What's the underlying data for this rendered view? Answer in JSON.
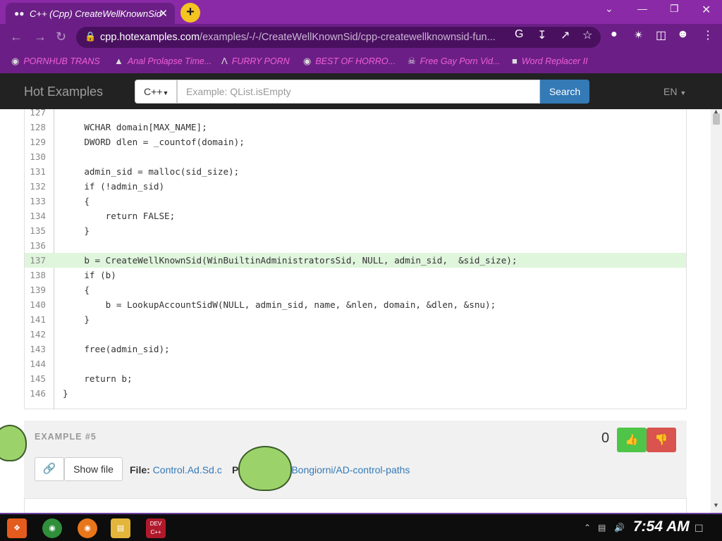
{
  "browser": {
    "tab_title": "C++ (Cpp) CreateWellKnownSid",
    "new_tab_label": "+",
    "url_domain": "cpp.hotexamples.com",
    "url_path": "/examples/-/-/CreateWellKnownSid/cpp-createwellknownsid-fun..."
  },
  "bookmarks": [
    {
      "label": "PORNHUB TRANS",
      "icon": "globe-icon"
    },
    {
      "label": "Anal Prolapse Time...",
      "icon": "flame-icon"
    },
    {
      "label": "FURRY PORN",
      "icon": "lambda-icon"
    },
    {
      "label": "BEST OF HORRO...",
      "icon": "globe-icon"
    },
    {
      "label": "Free Gay Porn Vid...",
      "icon": "skull-icon"
    },
    {
      "label": "Word Replacer II",
      "icon": "wr-icon"
    }
  ],
  "navbar": {
    "brand": "Hot Examples",
    "language_select": "C++",
    "search_placeholder": "Example: QList.isEmpty",
    "search_button": "Search",
    "locale": "EN"
  },
  "code": {
    "highlight_line": "137",
    "lines": [
      {
        "n": "127",
        "t": ""
      },
      {
        "n": "128",
        "t": "    WCHAR domain[MAX_NAME];"
      },
      {
        "n": "129",
        "t": "    DWORD dlen = _countof(domain);"
      },
      {
        "n": "130",
        "t": ""
      },
      {
        "n": "131",
        "t": "    admin_sid = malloc(sid_size);"
      },
      {
        "n": "132",
        "t": "    if (!admin_sid)"
      },
      {
        "n": "133",
        "t": "    {"
      },
      {
        "n": "134",
        "t": "        return FALSE;"
      },
      {
        "n": "135",
        "t": "    }"
      },
      {
        "n": "136",
        "t": ""
      },
      {
        "n": "137",
        "t": "    b = CreateWellKnownSid(WinBuiltinAdministratorsSid, NULL, admin_sid,  &sid_size);"
      },
      {
        "n": "138",
        "t": "    if (b)"
      },
      {
        "n": "139",
        "t": "    {"
      },
      {
        "n": "140",
        "t": "        b = LookupAccountSidW(NULL, admin_sid, name, &nlen, domain, &dlen, &snu);"
      },
      {
        "n": "141",
        "t": "    }"
      },
      {
        "n": "142",
        "t": ""
      },
      {
        "n": "143",
        "t": "    free(admin_sid);"
      },
      {
        "n": "144",
        "t": ""
      },
      {
        "n": "145",
        "t": "    return b;"
      },
      {
        "n": "146",
        "t": "}"
      }
    ]
  },
  "example": {
    "title": "EXAMPLE #5",
    "score": "0",
    "show_file": "Show file",
    "file_label": "File:",
    "file_name": "Control.Ad.Sd.c",
    "project_label": "P",
    "project_name": "Bongiorni/AD-control-paths"
  },
  "taskbar": {
    "clock": "7:54 AM",
    "devcpp_label": "DEV C++"
  },
  "colors": {
    "browser_accent": "#6b1f86",
    "navbar_bg": "#222222",
    "search_button": "#337ab7",
    "upvote": "#4ec549",
    "downvote": "#d9534f",
    "highlight": "#dff5dc"
  }
}
